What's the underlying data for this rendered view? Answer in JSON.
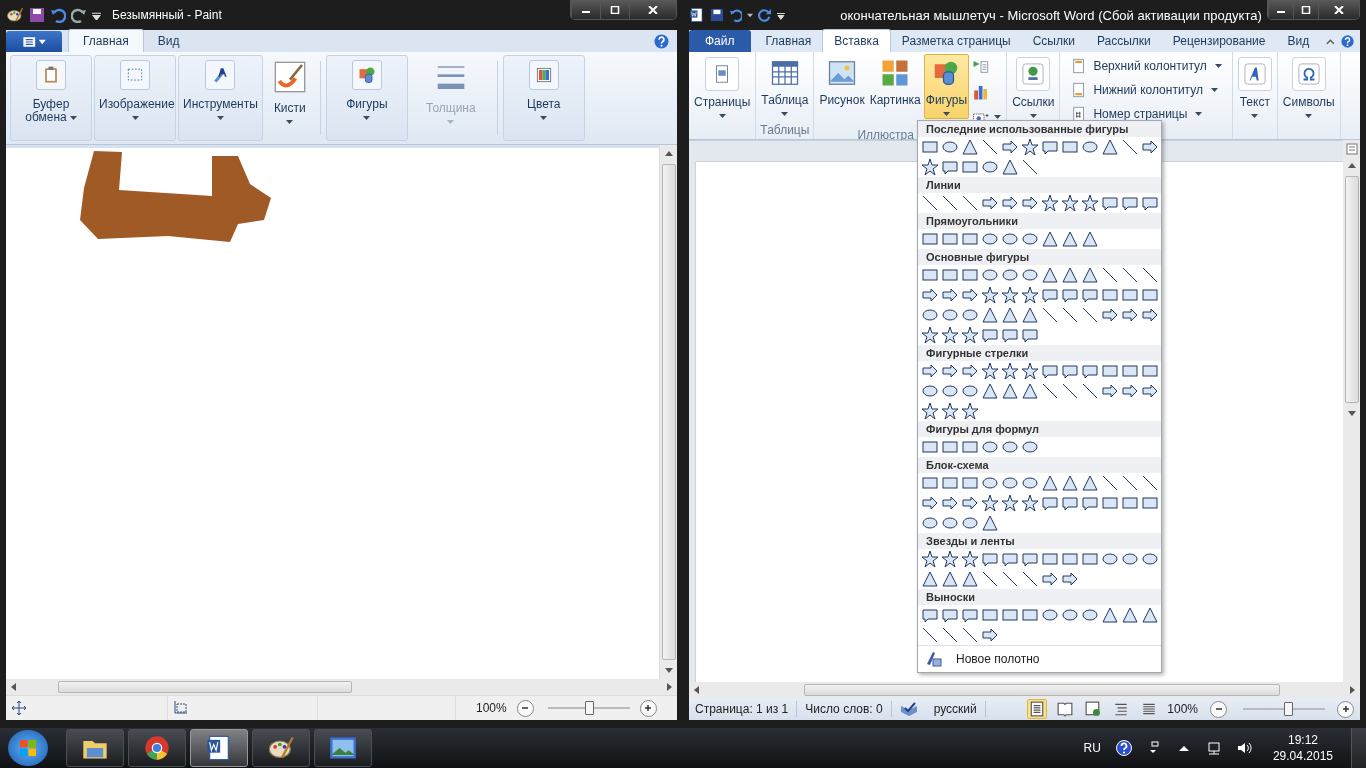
{
  "paint": {
    "title": "Безымянный - Paint",
    "tabs": [
      {
        "label": "Главная",
        "selected": true
      },
      {
        "label": "Вид",
        "selected": false
      }
    ],
    "ribbon_groups": [
      {
        "label": "Буфер обмена",
        "kind": "clipboard",
        "framed": true,
        "disabled": false
      },
      {
        "label": "Изображение",
        "kind": "select",
        "framed": true,
        "disabled": false
      },
      {
        "label": "Инструменты",
        "kind": "tools",
        "framed": true,
        "disabled": false
      },
      {
        "label": "Кисти",
        "kind": "brush",
        "framed": false,
        "disabled": false
      },
      {
        "label": "Фигуры",
        "kind": "shapes",
        "framed": true,
        "disabled": false
      },
      {
        "label": "Толщина",
        "kind": "size",
        "framed": false,
        "disabled": true
      },
      {
        "label": "Цвета",
        "kind": "colors",
        "framed": true,
        "disabled": false
      }
    ],
    "status_bar": {
      "zoom": "100%",
      "zoom_slider": {
        "level": 0.5
      }
    }
  },
  "word": {
    "title": "окончательная мышлетуч  -  Microsoft Word (Сбой активации продукта)",
    "tabs": [
      {
        "label": "Файл",
        "kind": "file",
        "selected": false
      },
      {
        "label": "Главная",
        "kind": "tab",
        "selected": false
      },
      {
        "label": "Вставка",
        "kind": "tab",
        "selected": true
      },
      {
        "label": "Разметка страницы",
        "kind": "tab",
        "selected": false
      },
      {
        "label": "Ссылки",
        "kind": "tab",
        "selected": false
      },
      {
        "label": "Рассылки",
        "kind": "tab",
        "selected": false
      },
      {
        "label": "Рецензирование",
        "kind": "tab",
        "selected": false
      },
      {
        "label": "Вид",
        "kind": "tab",
        "selected": false
      }
    ],
    "ribbon_groups": [
      {
        "items": [
          {
            "kind": "pages",
            "label": "Страницы",
            "caret": true,
            "selected": false
          }
        ]
      },
      {
        "label": "Таблицы",
        "items": [
          {
            "kind": "table",
            "label": "Таблица",
            "caret": true,
            "selected": false
          }
        ]
      },
      {
        "label": "Иллюстра",
        "items": [
          {
            "kind": "picture",
            "label": "Рисунок",
            "caret": false,
            "selected": false
          },
          {
            "kind": "clipart",
            "label": "Картинка",
            "caret": false,
            "selected": false
          },
          {
            "kind": "shapes",
            "label": "Фигуры",
            "caret": true,
            "selected": true
          },
          {
            "kind": "smartart",
            "caret": false,
            "selected": false
          },
          {
            "kind": "chart",
            "caret": false,
            "selected": false
          },
          {
            "kind": "screenshot",
            "caret": true,
            "selected": false
          }
        ]
      },
      {
        "items": [
          {
            "kind": "links",
            "label": "Ссылки",
            "caret": true,
            "selected": false
          }
        ]
      },
      {
        "items": [
          {
            "kind": "header",
            "label": "Верхний колонтитул",
            "caret": true,
            "selected": false
          },
          {
            "kind": "footer",
            "label": "Нижний колонтитул",
            "caret": true,
            "selected": false
          },
          {
            "kind": "pagenum",
            "label": "Номер страницы",
            "caret": true,
            "selected": false
          }
        ]
      },
      {
        "items": [
          {
            "kind": "text",
            "label": "Текст",
            "caret": true,
            "selected": false
          }
        ]
      },
      {
        "items": [
          {
            "kind": "symbols",
            "label": "Символы",
            "caret": true,
            "selected": false
          }
        ]
      }
    ],
    "shapes_menu": {
      "sections": [
        {
          "title": "Последние использованные фигуры"
        },
        {
          "title": "Линии"
        },
        {
          "title": "Прямоугольники"
        },
        {
          "title": "Основные фигуры"
        },
        {
          "title": "Фигурные стрелки"
        },
        {
          "title": "Фигуры для формул"
        },
        {
          "title": "Блок-схема"
        },
        {
          "title": "Звезды и ленты"
        },
        {
          "title": "Выноски"
        }
      ],
      "footer": "Новое полотно"
    },
    "status_bar": {
      "page": "Страница: 1 из 1",
      "words": "Число слов: 0",
      "language": "русский",
      "views": [
        {
          "selected": true
        },
        {
          "selected": false
        },
        {
          "selected": false
        },
        {
          "selected": false
        },
        {
          "selected": false
        }
      ],
      "zoom": "100%",
      "zoom_slider": {
        "level": 0.55
      }
    }
  },
  "taskbar": {
    "apps": [
      {
        "kind": "explorer",
        "active": false
      },
      {
        "kind": "chrome",
        "active": false
      },
      {
        "kind": "word",
        "active": true
      },
      {
        "kind": "paint",
        "active": false
      },
      {
        "kind": "photos",
        "active": false
      }
    ],
    "tray": {
      "language": "RU",
      "time": "19:12",
      "date": "29.04.2015"
    }
  }
}
